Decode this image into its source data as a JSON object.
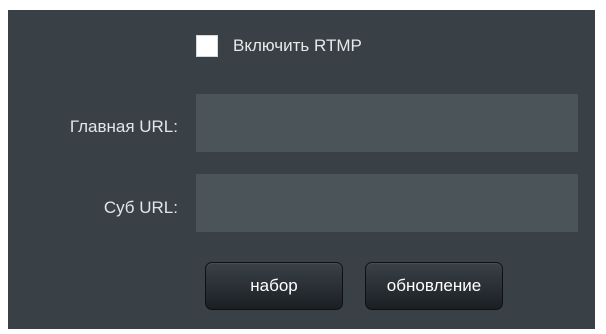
{
  "rtmp": {
    "enable_label": "Включить RTMP",
    "enabled": false
  },
  "fields": {
    "main_url_label": "Главная URL:",
    "main_url_value": "",
    "sub_url_label": "Суб URL:",
    "sub_url_value": ""
  },
  "buttons": {
    "set_label": "набор",
    "update_label": "обновление"
  },
  "colors": {
    "panel_bg": "#394146",
    "input_bg": "#4b5559",
    "text": "#e2e6e8"
  }
}
